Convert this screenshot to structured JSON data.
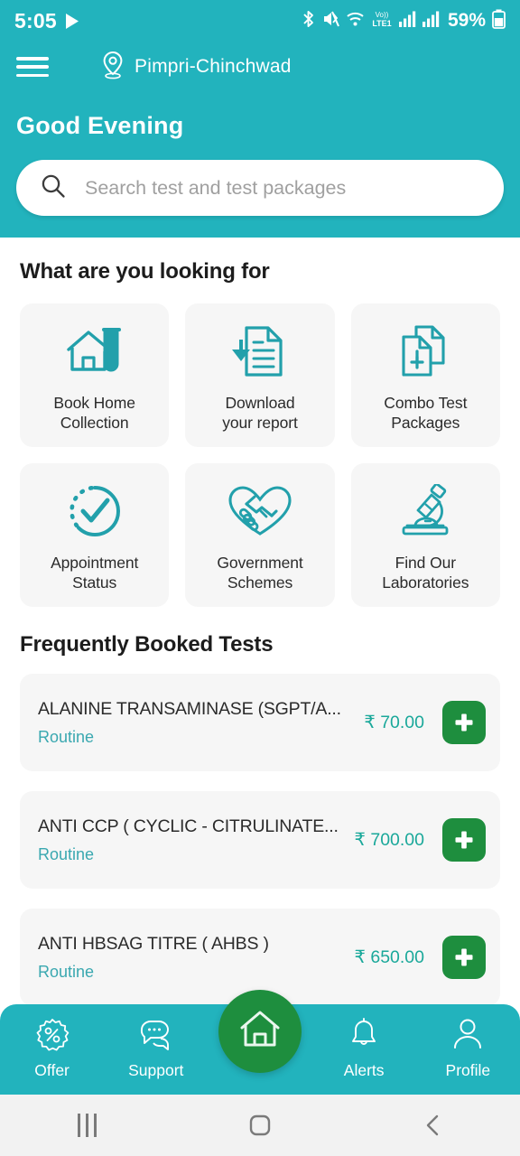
{
  "status_bar": {
    "time": "5:05",
    "battery": "59%",
    "icons": [
      "play-store-icon",
      "bluetooth-icon",
      "mute-vibrate-icon",
      "wifi-icon",
      "volte-icon",
      "signal-1-icon",
      "signal-2-icon",
      "battery-icon"
    ]
  },
  "header": {
    "menu_icon": "hamburger-menu-icon",
    "location_icon": "location-pin-icon",
    "location": "Pimpri-Chinchwad",
    "greeting": "Good Evening",
    "background_color": "#22b3bd"
  },
  "search": {
    "placeholder": "Search test and test packages",
    "value": "",
    "icon": "search-icon"
  },
  "looking_for": {
    "title": "What are you looking for",
    "tiles": [
      {
        "label": "Book Home\nCollection",
        "line1": "Book Home",
        "line2": "Collection",
        "icon": "home-testtube-icon"
      },
      {
        "label": "Download\nyour report",
        "line1": "Download",
        "line2": "your report",
        "icon": "document-download-icon"
      },
      {
        "label": "Combo Test\nPackages",
        "line1": "Combo Test",
        "line2": "Packages",
        "icon": "combo-documents-plus-icon"
      },
      {
        "label": "Appointment\nStatus",
        "line1": "Appointment",
        "line2": "Status",
        "icon": "check-circle-dashed-icon"
      },
      {
        "label": "Government\nSchemes",
        "line1": "Government",
        "line2": "Schemes",
        "icon": "handshake-heart-icon"
      },
      {
        "label": "Find Our\nLaboratories",
        "line1": "Find Our",
        "line2": "Laboratories",
        "icon": "microscope-icon"
      }
    ]
  },
  "frequently_booked": {
    "title": "Frequently Booked Tests",
    "items": [
      {
        "name": "ALANINE TRANSAMINASE (SGPT/A...",
        "type": "Routine",
        "price": "₹ 70.00",
        "add_icon": "plus-icon"
      },
      {
        "name": "ANTI CCP ( CYCLIC - CITRULINATE...",
        "type": "Routine",
        "price": "₹ 700.00",
        "add_icon": "plus-icon"
      },
      {
        "name": "ANTI HBSAG TITRE ( AHBS )",
        "type": "Routine",
        "price": "₹ 650.00",
        "add_icon": "plus-icon"
      }
    ]
  },
  "bottom_nav": {
    "items": [
      {
        "label": "Offer",
        "icon": "discount-percent-icon"
      },
      {
        "label": "Support",
        "icon": "chat-support-icon"
      },
      {
        "label": "",
        "icon": "home-icon"
      },
      {
        "label": "Alerts",
        "icon": "bell-icon"
      },
      {
        "label": "Profile",
        "icon": "person-icon"
      }
    ],
    "active": "home-icon",
    "accent_color": "#1e8e3e"
  },
  "android_nav": {
    "recent_icon": "recent-apps-icon",
    "home_icon": "android-home-icon",
    "back_icon": "android-back-icon"
  },
  "colors": {
    "teal": "#22b3bd",
    "icon_teal": "#22a0ab",
    "green": "#1e8e3e",
    "price": "#1aa89a",
    "card_bg": "#f6f6f6"
  }
}
